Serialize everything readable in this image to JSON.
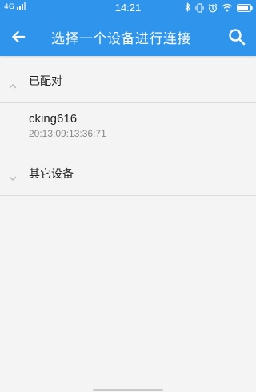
{
  "status_bar": {
    "network": "4G",
    "time": "14:21",
    "icons": [
      "bluetooth-icon",
      "vibrate-icon",
      "alarm-icon",
      "wifi-icon",
      "battery-icon"
    ]
  },
  "app_bar": {
    "title": "选择一个设备进行连接",
    "back_icon": "arrow-left-icon",
    "search_icon": "search-icon"
  },
  "sections": {
    "paired": {
      "label": "已配对",
      "expanded": true,
      "devices": [
        {
          "name": "cking616",
          "address": "20:13:09:13:36:71"
        }
      ]
    },
    "other": {
      "label": "其它设备",
      "expanded": false
    }
  },
  "colors": {
    "primary": "#2f95ec",
    "background": "#f4f4f4",
    "divider": "#dcdcdc",
    "secondary_text": "#888888"
  }
}
